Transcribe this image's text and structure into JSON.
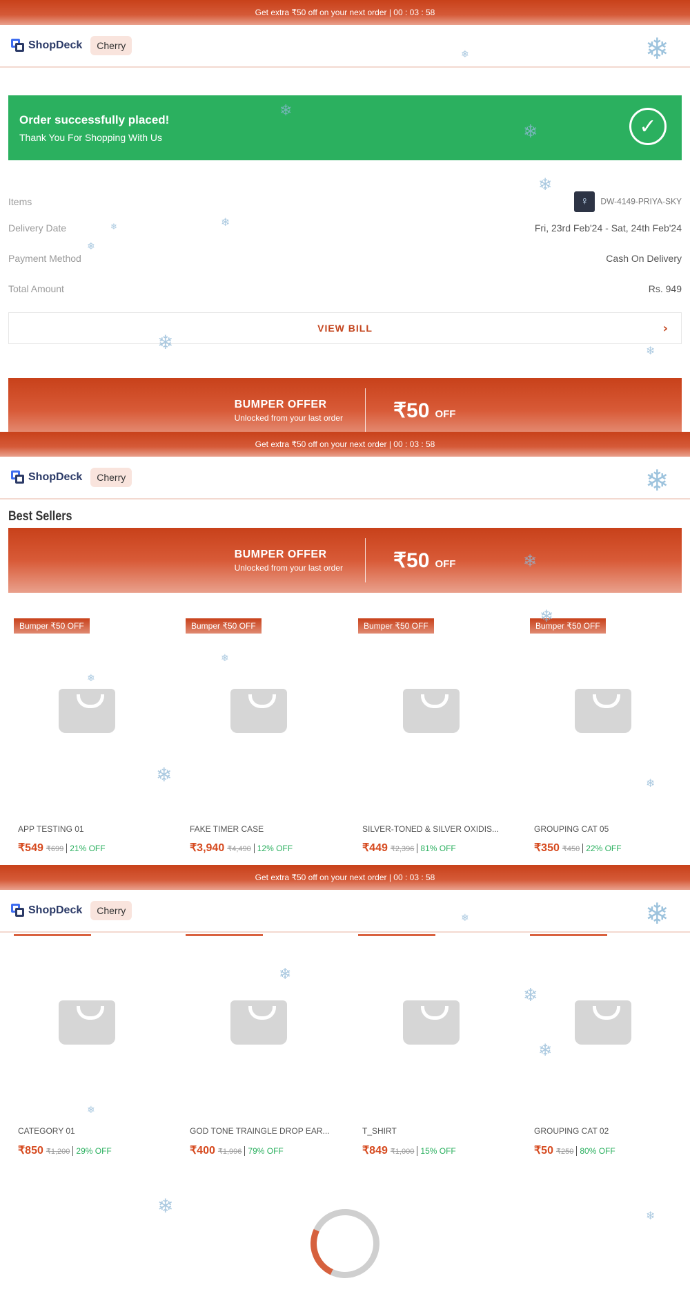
{
  "promo_strip": {
    "text": "Get extra ₹50 off on your next order | 00 : 03 : 58"
  },
  "header": {
    "logo_text": "ShopDeck",
    "store_name": "Cherry"
  },
  "success": {
    "title": "Order successfully placed!",
    "subtitle": "Thank You For Shopping With Us"
  },
  "order_details": {
    "items_label": "Items",
    "items_value": "DW-4149-PRIYA-SKY",
    "delivery_label": "Delivery Date",
    "delivery_value": "Fri, 23rd Feb'24 - Sat, 24th Feb'24",
    "payment_label": "Payment Method",
    "payment_value": "Cash On Delivery",
    "total_label": "Total Amount",
    "total_value": "Rs. 949"
  },
  "view_bill": {
    "label": "VIEW BILL"
  },
  "bumper_offer": {
    "title": "BUMPER OFFER",
    "subtitle": "Unlocked from your last order",
    "amount": "₹50",
    "off": "OFF"
  },
  "best_sellers": {
    "title": "Best Sellers",
    "badge_label": "Bumper ₹50 OFF"
  },
  "products_row1": [
    {
      "name": "APP TESTING 01",
      "price": "₹549",
      "mrp": "₹699",
      "discount": "21% OFF"
    },
    {
      "name": "FAKE TIMER CASE",
      "price": "₹3,940",
      "mrp": "₹4,490",
      "discount": "12% OFF"
    },
    {
      "name": "SILVER-TONED & SILVER OXIDIS...",
      "price": "₹449",
      "mrp": "₹2,396",
      "discount": "81% OFF"
    },
    {
      "name": "GROUPING CAT 05",
      "price": "₹350",
      "mrp": "₹450",
      "discount": "22% OFF"
    }
  ],
  "products_row2": [
    {
      "name": "CATEGORY 01",
      "price": "₹850",
      "mrp": "₹1,200",
      "discount": "29% OFF"
    },
    {
      "name": "GOD TONE TRAINGLE DROP EAR...",
      "price": "₹400",
      "mrp": "₹1,996",
      "discount": "79% OFF"
    },
    {
      "name": "T_SHIRT",
      "price": "₹849",
      "mrp": "₹1,000",
      "discount": "15% OFF"
    },
    {
      "name": "GROUPING CAT 02",
      "price": "₹50",
      "mrp": "₹250",
      "discount": "80% OFF"
    }
  ],
  "icons": {
    "check": "check-circle-icon",
    "chevron": "chevron-right-icon",
    "snowflake": "snowflake-icon",
    "bag": "shopping-bag-icon",
    "spinner": "loading-spinner-icon"
  },
  "colors": {
    "accent": "#c8411a",
    "success": "#2bb05f",
    "discount": "#2bb05f",
    "price": "#d64a1f"
  }
}
